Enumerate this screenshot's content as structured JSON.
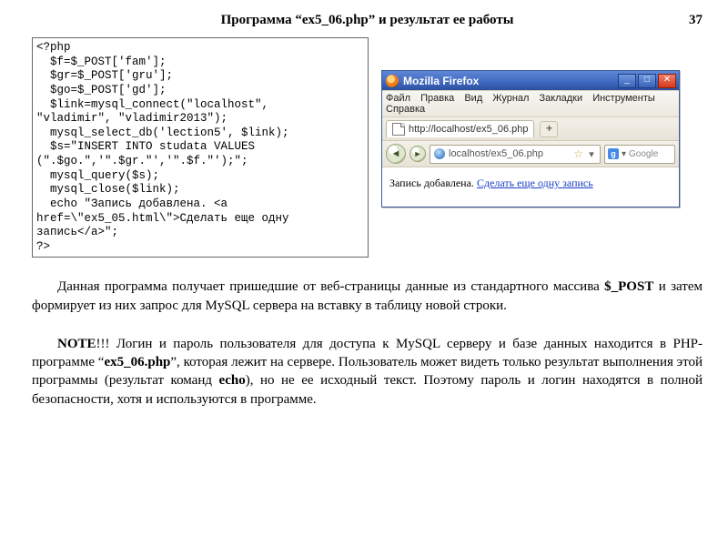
{
  "header": {
    "title": "Программа “ex5_06.php” и  результат  ее  работы",
    "page_number": "37"
  },
  "code_block": "<?php\n  $f=$_POST['fam'];\n  $gr=$_POST['gru'];\n  $go=$_POST['gd'];\n  $link=mysql_connect(\"localhost\",\n\"vladimir\", \"vladimir2013\");\n  mysql_select_db('lection5', $link);\n  $s=\"INSERT INTO studata VALUES\n(\".$go.\",'\".$gr.\"','\".$f.\"');\";\n  mysql_query($s);\n  mysql_close($link);\n  echo \"Запись добавлена. <a\nhref=\\\"ex5_05.html\\\">Сделать еще одну\nзапись</a>\";\n?>",
  "browser": {
    "title": "Mozilla Firefox",
    "menu": {
      "file": "Файл",
      "edit": "Правка",
      "view": "Вид",
      "journal": "Журнал",
      "bookmarks": "Закладки",
      "tools": "Инструменты",
      "help": "Справка"
    },
    "tab_label": "http://localhost/ex5_06.php",
    "url": "localhost/ex5_06.php",
    "search_placeholder": "Google",
    "page_text": "Запись добавлена. ",
    "page_link": "Сделать еще одну запись"
  },
  "paragraphs": {
    "p1_prefix": "Данная  программа  получает  пришедшие  от  веб-страницы  данные  из стандартного  массива ",
    "p1_bold1": "$_POST",
    "p1_suffix": " и  затем формирует  из   них    запрос    для MySQL сервера  на  вставку  в  таблицу новой строки.",
    "p2_bold1": "NOTE",
    "p2_mid1": "!!!  Логин  и  пароль  пользователя для  доступа  к MySQL  серверу  и  базе данных   находится   в   PHP-программе   “",
    "p2_bold2": "ex5_06.php",
    "p2_mid2": "”,   которая   лежит  на  сервере. Пользователь  может  видеть  только  результат  выполнения этой  программы  (результат  команд ",
    "p2_bold3": "echo",
    "p2_suffix": "),  но  не  ее исходный  текст.  Поэтому  пароль  и  логин  находятся  в полной безопасности, хотя и используются в программе."
  }
}
